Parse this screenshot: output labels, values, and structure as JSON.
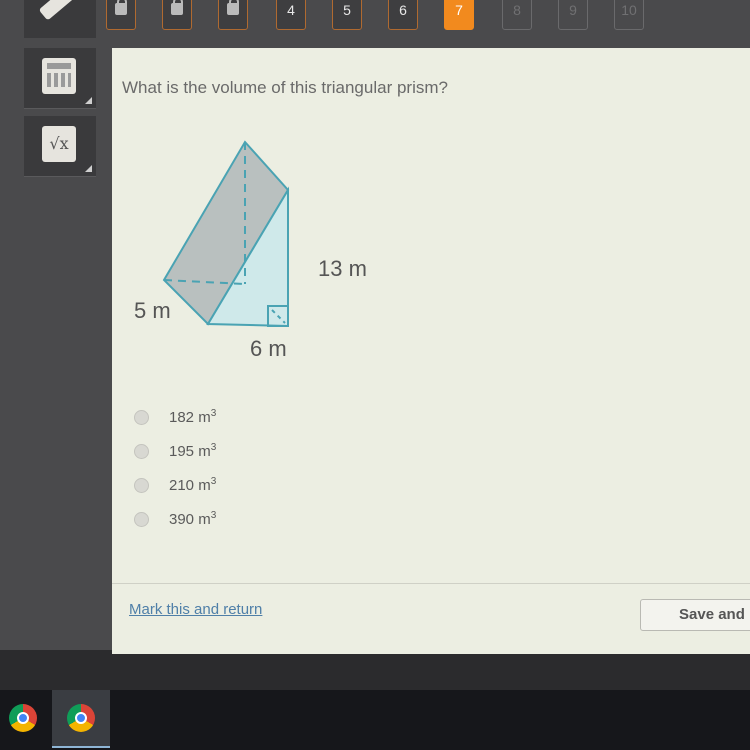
{
  "question_nav": {
    "items": [
      {
        "label": "",
        "state": "locked"
      },
      {
        "label": "",
        "state": "locked"
      },
      {
        "label": "",
        "state": "locked"
      },
      {
        "label": "4",
        "state": "answered"
      },
      {
        "label": "5",
        "state": "answered"
      },
      {
        "label": "6",
        "state": "answered"
      },
      {
        "label": "7",
        "state": "current"
      },
      {
        "label": "8",
        "state": "disabled"
      },
      {
        "label": "9",
        "state": "disabled"
      },
      {
        "label": "10",
        "state": "disabled"
      }
    ],
    "accent_color": "#f28a1e"
  },
  "tools": {
    "pencil": "pencil-icon",
    "calculator": "calculator-icon",
    "formula": "square-root-icon"
  },
  "question": {
    "text": "What is the volume of this triangular prism?",
    "figure": {
      "depth_label": "5 m",
      "base_label": "6 m",
      "height_label": "13 m"
    },
    "options": [
      {
        "value": "182 m",
        "exp": "3"
      },
      {
        "value": "195 m",
        "exp": "3"
      },
      {
        "value": "210 m",
        "exp": "3"
      },
      {
        "value": "390 m",
        "exp": "3"
      }
    ]
  },
  "footer": {
    "mark_link": "Mark this and return",
    "save_button": "Save and"
  },
  "taskbar": {
    "items": [
      "chrome-icon",
      "chrome-icon"
    ]
  }
}
